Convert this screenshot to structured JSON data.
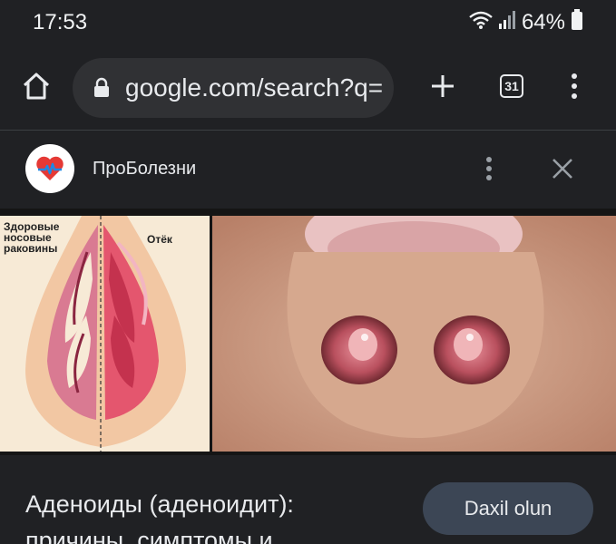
{
  "status_bar": {
    "time": "17:53",
    "battery_percent": "64%",
    "icons": [
      "wifi-icon",
      "signal-icon",
      "battery-icon"
    ]
  },
  "toolbar": {
    "url": "google.com/search?q=",
    "tab_count": "31",
    "icons": [
      "home-icon",
      "lock-icon",
      "plus-icon",
      "tabs-icon",
      "overflow-menu-icon"
    ]
  },
  "source": {
    "name": "ПроБолезни",
    "icons": [
      "site-logo-icon",
      "more-vert-icon",
      "close-icon"
    ]
  },
  "diagram": {
    "left_label": "Здоровые\nносовые\nраковины",
    "right_label": "Отёк"
  },
  "result": {
    "title": "Аденоиды (аденоидит): причины, симптомы и...",
    "visit_label": "Daxil olun"
  },
  "colors": {
    "background": "#202124",
    "url_pill": "#303134",
    "button": "#3c4655",
    "text": "#e8eaed"
  }
}
